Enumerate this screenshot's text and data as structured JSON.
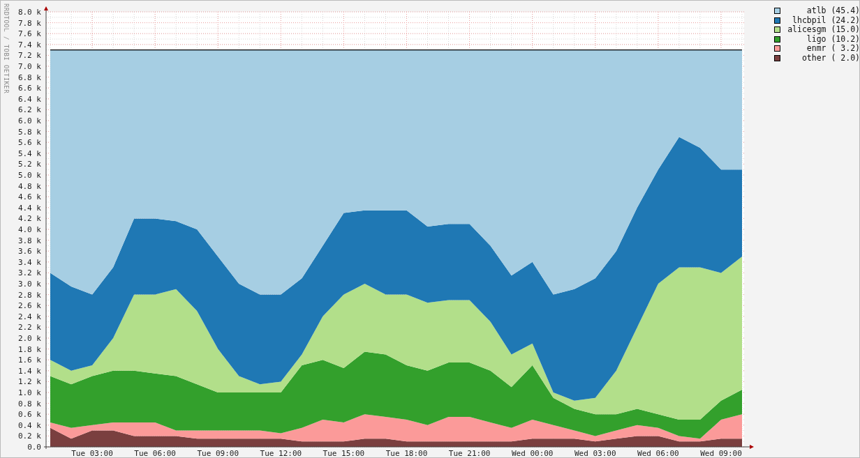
{
  "watermark_side_text": "RRDTOOL / TOBI OETIKER",
  "chart_data": {
    "type": "area",
    "stacked": true,
    "grid": true,
    "categories": [
      null,
      null,
      "Tue 03:00",
      null,
      null,
      "Tue 06:00",
      null,
      null,
      "Tue 09:00",
      null,
      null,
      "Tue 12:00",
      null,
      null,
      "Tue 15:00",
      null,
      null,
      "Tue 18:00",
      null,
      null,
      "Tue 21:00",
      null,
      null,
      "Wed 00:00",
      null,
      null,
      "Wed 03:00",
      null,
      null,
      "Wed 06:00",
      null,
      null,
      "Wed 09:00",
      null
    ],
    "ylim": [
      0,
      8
    ],
    "yticks": [
      {
        "value": 0,
        "label": "0.0"
      },
      {
        "value": 0.2,
        "label": "0.2 k"
      },
      {
        "value": 0.4,
        "label": "0.4 k"
      },
      {
        "value": 0.6,
        "label": "0.6 k"
      },
      {
        "value": 0.8,
        "label": "0.8 k"
      },
      {
        "value": 1.0,
        "label": "1.0 k"
      },
      {
        "value": 1.2,
        "label": "1.2 k"
      },
      {
        "value": 1.4,
        "label": "1.4 k"
      },
      {
        "value": 1.6,
        "label": "1.6 k"
      },
      {
        "value": 1.8,
        "label": "1.8 k"
      },
      {
        "value": 2.0,
        "label": "2.0 k"
      },
      {
        "value": 2.2,
        "label": "2.2 k"
      },
      {
        "value": 2.4,
        "label": "2.4 k"
      },
      {
        "value": 2.6,
        "label": "2.6 k"
      },
      {
        "value": 2.8,
        "label": "2.8 k"
      },
      {
        "value": 3.0,
        "label": "3.0 k"
      },
      {
        "value": 3.2,
        "label": "3.2 k"
      },
      {
        "value": 3.4,
        "label": "3.4 k"
      },
      {
        "value": 3.6,
        "label": "3.6 k"
      },
      {
        "value": 3.8,
        "label": "3.8 k"
      },
      {
        "value": 4.0,
        "label": "4.0 k"
      },
      {
        "value": 4.2,
        "label": "4.2 k"
      },
      {
        "value": 4.4,
        "label": "4.4 k"
      },
      {
        "value": 4.6,
        "label": "4.6 k"
      },
      {
        "value": 4.8,
        "label": "4.8 k"
      },
      {
        "value": 5.0,
        "label": "5.0 k"
      },
      {
        "value": 5.2,
        "label": "5.2 k"
      },
      {
        "value": 5.4,
        "label": "5.4 k"
      },
      {
        "value": 5.6,
        "label": "5.6 k"
      },
      {
        "value": 5.8,
        "label": "5.8 k"
      },
      {
        "value": 6.0,
        "label": "6.0 k"
      },
      {
        "value": 6.2,
        "label": "6.2 k"
      },
      {
        "value": 6.4,
        "label": "6.4 k"
      },
      {
        "value": 6.6,
        "label": "6.6 k"
      },
      {
        "value": 6.8,
        "label": "6.8 k"
      },
      {
        "value": 7.0,
        "label": "7.0 k"
      },
      {
        "value": 7.2,
        "label": "7.2 k"
      },
      {
        "value": 7.4,
        "label": "7.4 k"
      },
      {
        "value": 7.6,
        "label": "7.6 k"
      },
      {
        "value": 7.8,
        "label": "7.8 k"
      },
      {
        "value": 8.0,
        "label": "8.0 k"
      }
    ],
    "series": [
      {
        "name": "other",
        "color": "#7a3f3f",
        "values": [
          0.35,
          0.15,
          0.3,
          0.3,
          0.2,
          0.2,
          0.2,
          0.15,
          0.15,
          0.15,
          0.15,
          0.15,
          0.1,
          0.1,
          0.1,
          0.15,
          0.15,
          0.1,
          0.1,
          0.1,
          0.1,
          0.1,
          0.1,
          0.15,
          0.15,
          0.15,
          0.1,
          0.15,
          0.2,
          0.2,
          0.1,
          0.1,
          0.15,
          0.15
        ]
      },
      {
        "name": "enmr",
        "color": "#fb9a99",
        "values": [
          0.1,
          0.2,
          0.1,
          0.15,
          0.25,
          0.25,
          0.1,
          0.15,
          0.15,
          0.15,
          0.15,
          0.1,
          0.25,
          0.4,
          0.35,
          0.45,
          0.4,
          0.4,
          0.3,
          0.45,
          0.45,
          0.35,
          0.25,
          0.35,
          0.25,
          0.15,
          0.1,
          0.15,
          0.2,
          0.15,
          0.1,
          0.05,
          0.35,
          0.45
        ]
      },
      {
        "name": "ligo",
        "color": "#33a02c",
        "values": [
          0.85,
          0.8,
          0.9,
          0.95,
          0.95,
          0.9,
          1.0,
          0.85,
          0.7,
          0.7,
          0.7,
          0.75,
          1.15,
          1.1,
          1.0,
          1.15,
          1.15,
          1.0,
          1.0,
          1.0,
          1.0,
          0.95,
          0.75,
          1.0,
          0.5,
          0.4,
          0.4,
          0.3,
          0.3,
          0.25,
          0.3,
          0.35,
          0.35,
          0.45
        ]
      },
      {
        "name": "alicesgm",
        "color": "#b2df8a",
        "values": [
          0.3,
          0.25,
          0.2,
          0.6,
          1.4,
          1.45,
          1.6,
          1.35,
          0.8,
          0.3,
          0.15,
          0.2,
          0.2,
          0.8,
          1.35,
          1.25,
          1.1,
          1.3,
          1.25,
          1.15,
          1.15,
          0.9,
          0.6,
          0.4,
          0.1,
          0.15,
          0.3,
          0.8,
          1.5,
          2.4,
          2.8,
          2.8,
          2.35,
          2.45
        ]
      },
      {
        "name": "lhcbpil",
        "color": "#1f78b4",
        "values": [
          1.6,
          1.55,
          1.3,
          1.3,
          1.4,
          1.4,
          1.25,
          1.5,
          1.7,
          1.7,
          1.65,
          1.6,
          1.4,
          1.3,
          1.5,
          1.35,
          1.55,
          1.55,
          1.4,
          1.4,
          1.4,
          1.4,
          1.45,
          1.5,
          1.8,
          2.05,
          2.2,
          2.2,
          2.2,
          2.1,
          2.4,
          2.2,
          1.9,
          1.6
        ]
      },
      {
        "name": "atlb",
        "color": "#a6cee3",
        "values": [
          4.1,
          4.35,
          4.5,
          4.0,
          3.1,
          3.1,
          3.15,
          3.3,
          3.8,
          4.3,
          4.5,
          4.5,
          4.2,
          3.6,
          3.0,
          2.95,
          2.95,
          2.95,
          3.25,
          3.2,
          3.2,
          3.6,
          4.15,
          3.9,
          4.5,
          4.4,
          4.2,
          3.7,
          2.9,
          2.2,
          1.6,
          1.8,
          2.2,
          2.2
        ]
      }
    ]
  },
  "legend": [
    {
      "value": "(45.4)"
    },
    {
      "value": "(24.2)"
    },
    {
      "value": "(15.0)"
    },
    {
      "value": "(10.2)"
    },
    {
      "value": "( 3.2)"
    },
    {
      "value": "( 2.0)"
    }
  ]
}
